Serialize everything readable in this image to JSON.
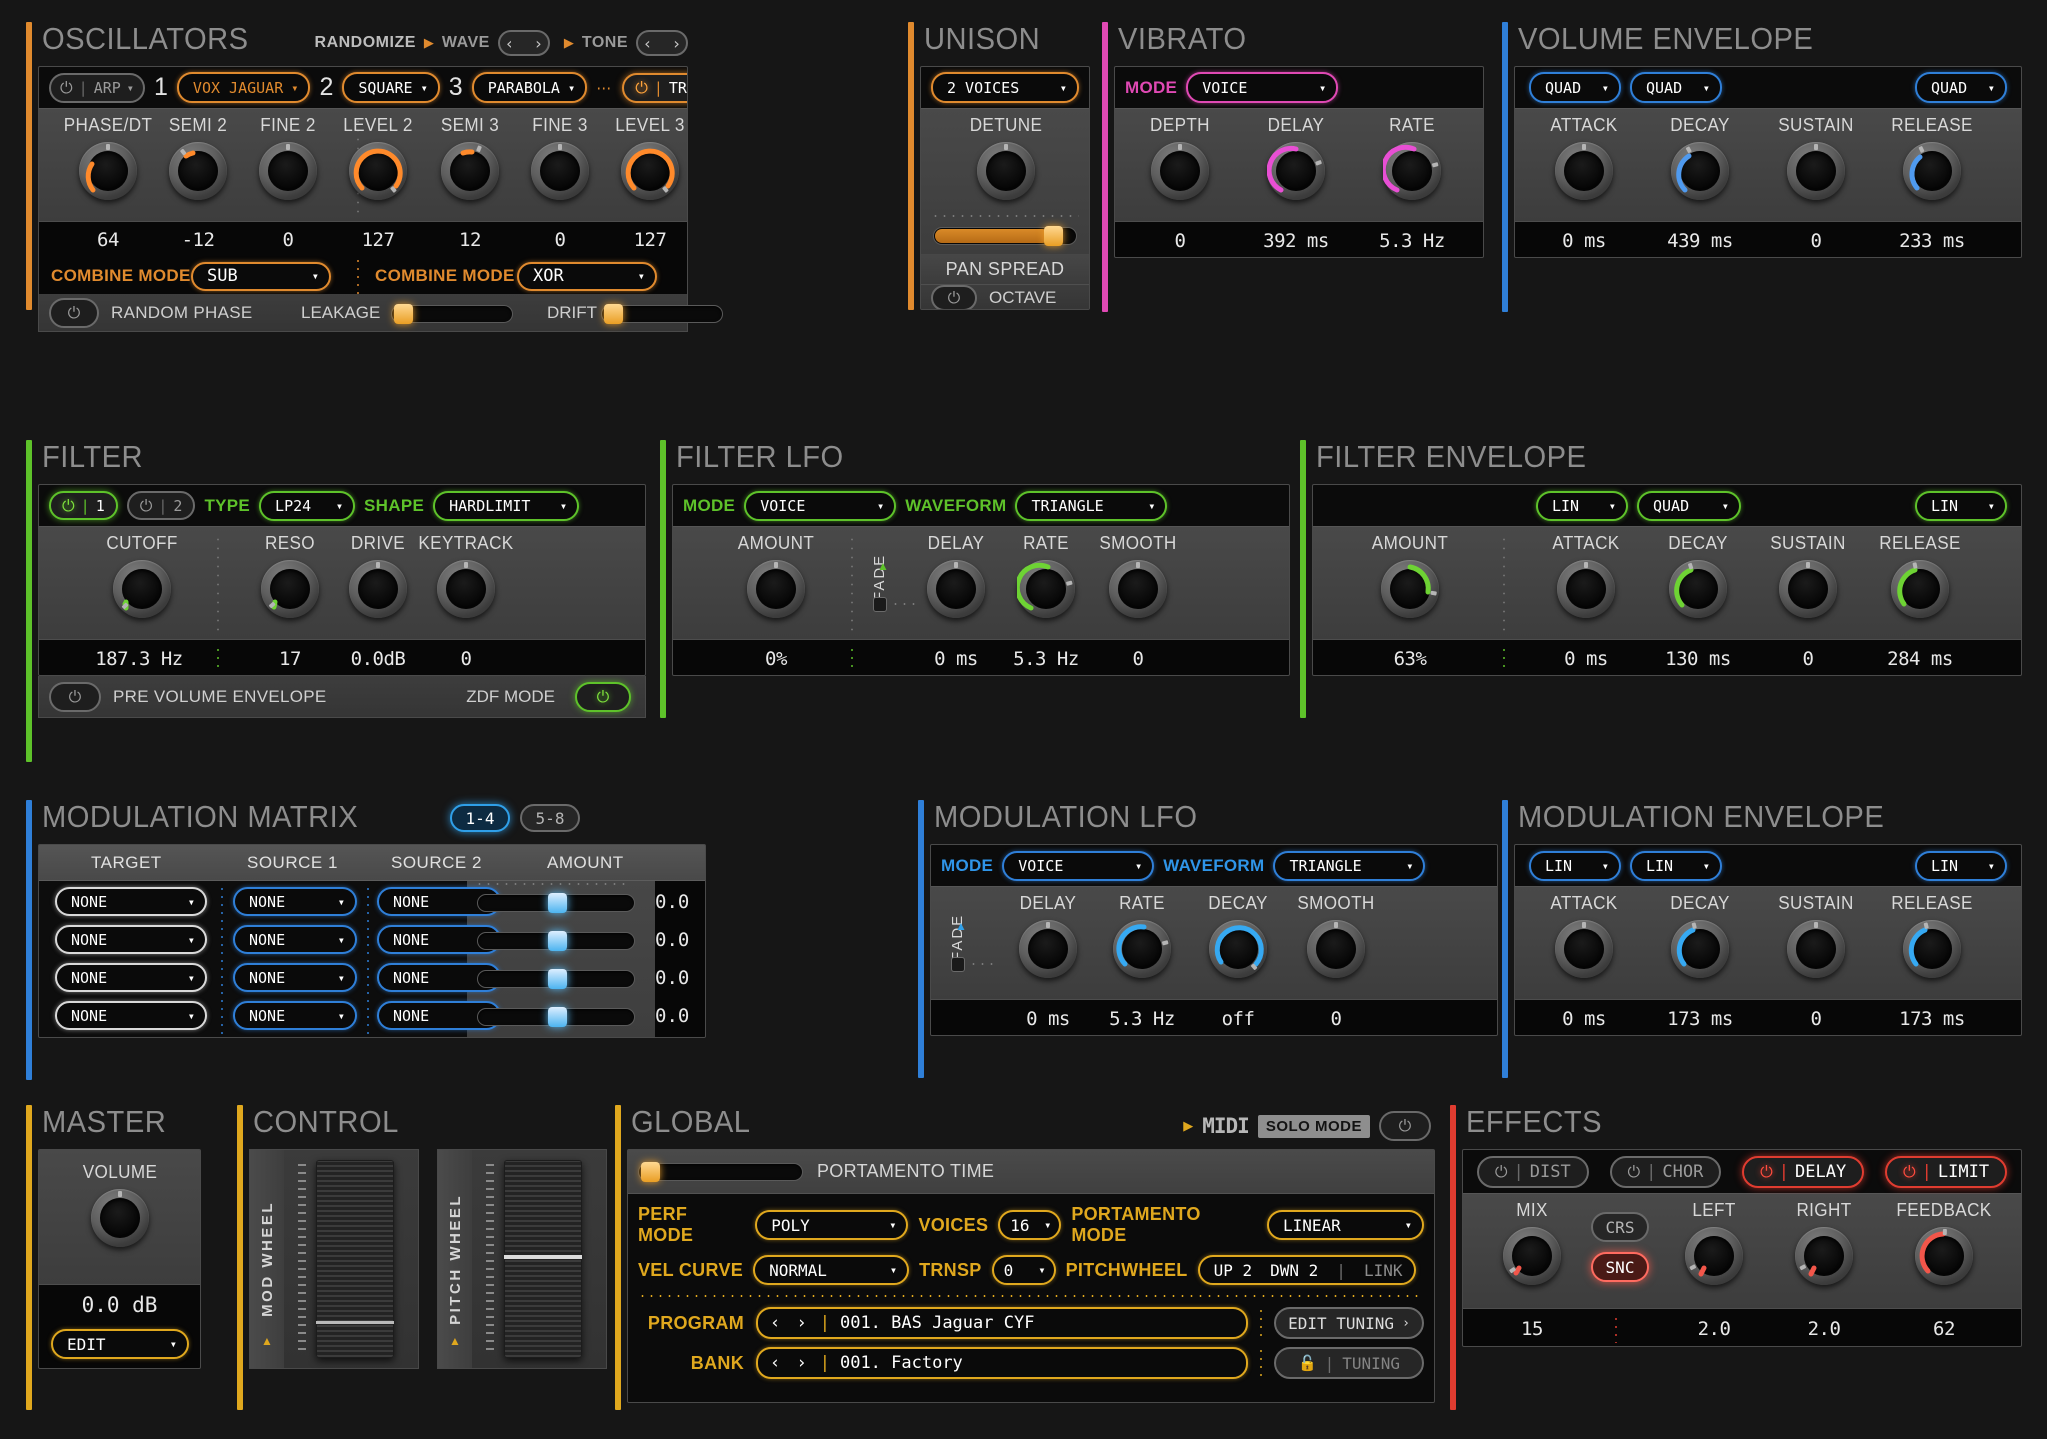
{
  "oscillators": {
    "title": "OSCILLATORS",
    "randomize_label": "RANDOMIZE",
    "wave_label": "WAVE",
    "tone_label": "TONE",
    "arp_label": "ARP",
    "trk_label": "TRK",
    "osc_numbers": [
      "1",
      "2",
      "3"
    ],
    "osc_types": [
      "VOX JAGUAR",
      "SQUARE",
      "PARABOLA"
    ],
    "knob_labels": [
      "PHASE/DT",
      "SEMI 2",
      "FINE 2",
      "LEVEL 2",
      "SEMI 3",
      "FINE 3",
      "LEVEL 3"
    ],
    "values": [
      "64",
      "-12",
      "0",
      "127",
      "12",
      "0",
      "127"
    ],
    "combine_mode_label": "COMBINE MODE",
    "combine_modes": [
      "SUB",
      "XOR"
    ],
    "random_phase_label": "RANDOM PHASE",
    "leakage_label": "LEAKAGE",
    "drift_label": "DRIFT"
  },
  "unison": {
    "title": "UNISON",
    "voices": "2 VOICES",
    "detune_label": "DETUNE",
    "pan_spread_label": "PAN SPREAD",
    "octave_label": "OCTAVE"
  },
  "vibrato": {
    "title": "VIBRATO",
    "mode_label": "MODE",
    "mode_value": "VOICE",
    "knob_labels": [
      "DEPTH",
      "DELAY",
      "RATE"
    ],
    "values": [
      "0",
      "392 ms",
      "5.3 Hz"
    ]
  },
  "volume_envelope": {
    "title": "VOLUME ENVELOPE",
    "curves": [
      "QUAD",
      "QUAD",
      "QUAD"
    ],
    "knob_labels": [
      "ATTACK",
      "DECAY",
      "SUSTAIN",
      "RELEASE"
    ],
    "values": [
      "0 ms",
      "439 ms",
      "0",
      "233 ms"
    ]
  },
  "filter": {
    "title": "FILTER",
    "slot1": "1",
    "slot2": "2",
    "type_label": "TYPE",
    "type_value": "LP24",
    "shape_label": "SHAPE",
    "shape_value": "HARDLIMIT",
    "knob_labels": [
      "CUTOFF",
      "RESO",
      "DRIVE",
      "KEYTRACK"
    ],
    "values": [
      "187.3 Hz",
      "17",
      "0.0dB",
      "0"
    ],
    "pre_volume_envelope_label": "PRE VOLUME ENVELOPE",
    "zdf_mode_label": "ZDF MODE"
  },
  "filter_lfo": {
    "title": "FILTER LFO",
    "mode_label": "MODE",
    "mode_value": "VOICE",
    "waveform_label": "WAVEFORM",
    "waveform_value": "TRIANGLE",
    "fade_label": "FADE",
    "knob_labels": [
      "AMOUNT",
      "DELAY",
      "RATE",
      "SMOOTH"
    ],
    "values": [
      "0%",
      "0 ms",
      "5.3 Hz",
      "0"
    ]
  },
  "filter_envelope": {
    "title": "FILTER ENVELOPE",
    "curves": [
      "LIN",
      "QUAD",
      "LIN"
    ],
    "knob_labels": [
      "AMOUNT",
      "ATTACK",
      "DECAY",
      "SUSTAIN",
      "RELEASE"
    ],
    "values": [
      "63%",
      "0 ms",
      "130 ms",
      "0",
      "284 ms"
    ]
  },
  "modulation_matrix": {
    "title": "MODULATION MATRIX",
    "page_tabs": [
      "1-4",
      "5-8"
    ],
    "active_tab": "1-4",
    "columns": [
      "TARGET",
      "SOURCE 1",
      "SOURCE 2",
      "AMOUNT"
    ],
    "rows": [
      {
        "target": "NONE",
        "source1": "NONE",
        "source2": "NONE",
        "amount": "0.0"
      },
      {
        "target": "NONE",
        "source1": "NONE",
        "source2": "NONE",
        "amount": "0.0"
      },
      {
        "target": "NONE",
        "source1": "NONE",
        "source2": "NONE",
        "amount": "0.0"
      },
      {
        "target": "NONE",
        "source1": "NONE",
        "source2": "NONE",
        "amount": "0.0"
      }
    ]
  },
  "modulation_lfo": {
    "title": "MODULATION LFO",
    "mode_label": "MODE",
    "mode_value": "VOICE",
    "waveform_label": "WAVEFORM",
    "waveform_value": "TRIANGLE",
    "fade_label": "FADE",
    "knob_labels": [
      "DELAY",
      "RATE",
      "DECAY",
      "SMOOTH"
    ],
    "values": [
      "0 ms",
      "5.3 Hz",
      "off",
      "0"
    ]
  },
  "modulation_envelope": {
    "title": "MODULATION ENVELOPE",
    "curves": [
      "LIN",
      "LIN",
      "LIN"
    ],
    "knob_labels": [
      "ATTACK",
      "DECAY",
      "SUSTAIN",
      "RELEASE"
    ],
    "values": [
      "0 ms",
      "173 ms",
      "0",
      "173 ms"
    ]
  },
  "master": {
    "title": "MASTER",
    "volume_label": "VOLUME",
    "volume_value": "0.0 dB",
    "edit_label": "EDIT"
  },
  "control": {
    "title": "CONTROL",
    "mod_wheel_label": "MOD WHEEL",
    "pitch_wheel_label": "PITCH WHEEL"
  },
  "global": {
    "title": "GLOBAL",
    "midi_label": "MIDI",
    "solo_mode_label": "SOLO MODE",
    "portamento_time_label": "PORTAMENTO TIME",
    "perf_mode_label": "PERF MODE",
    "perf_mode_value": "POLY",
    "voices_label": "VOICES",
    "voices_value": "16",
    "portamento_mode_label": "PORTAMENTO MODE",
    "portamento_mode_value": "LINEAR",
    "vel_curve_label": "VEL CURVE",
    "vel_curve_value": "NORMAL",
    "trnsp_label": "TRNSP",
    "trnsp_value": "0",
    "pitchwheel_label": "PITCHWHEEL",
    "pitchwheel_up": "UP 2",
    "pitchwheel_dwn": "DWN 2",
    "pitchwheel_link": "LINK",
    "program_label": "PROGRAM",
    "program_value": "001. BAS Jaguar CYF",
    "bank_label": "BANK",
    "bank_value": "001. Factory",
    "edit_tuning_label": "EDIT TUNING",
    "tuning_label": "TUNING"
  },
  "effects": {
    "title": "EFFECTS",
    "buttons": [
      "DIST",
      "CHOR",
      "DELAY",
      "LIMIT"
    ],
    "active_buttons": [
      "DELAY",
      "LIMIT"
    ],
    "crs_label": "CRS",
    "snc_label": "SNC",
    "knob_labels": [
      "MIX",
      "LEFT",
      "RIGHT",
      "FEEDBACK"
    ],
    "values": [
      "15",
      "2.0",
      "2.0",
      "62"
    ]
  },
  "colors": {
    "orange": "#e08a2e",
    "green": "#5ec22a",
    "blue": "#2f7fd8",
    "pink": "#e049b4",
    "yellow": "#e0a81e",
    "red": "#e03c30",
    "panel": "#3b3b3b"
  }
}
